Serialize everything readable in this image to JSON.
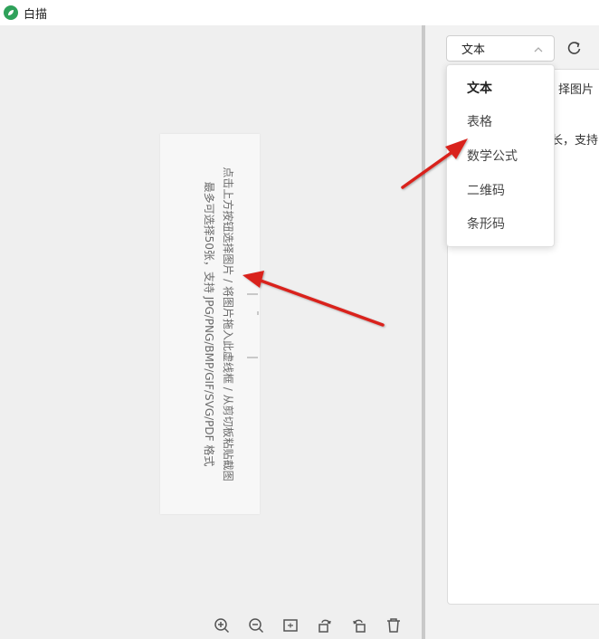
{
  "window": {
    "title": "白描",
    "logo_icon": "leaf-logo-icon",
    "logo_color": "#2fa15a"
  },
  "placeholder": {
    "line1": "点击上方按钮选择图片 / 将图片拖入此虚线框 / 从剪切板粘贴截图",
    "line2": "最多可选择50张，支持 JPG/PNG/BMP/GIF/SVG/PDF 格式"
  },
  "toolbar": {
    "icons": [
      "zoom-in-icon",
      "zoom-out-icon",
      "fit-icon",
      "rotate-right-icon",
      "rotate-left-icon",
      "delete-icon"
    ]
  },
  "select": {
    "value": "文本",
    "chevron_icon": "chevron-up-icon"
  },
  "refresh_icon": "refresh-icon",
  "dropdown": {
    "items": [
      "文本",
      "表格",
      "数学公式",
      "二维码",
      "条形码"
    ],
    "selected_index": 0
  },
  "result": {
    "line1_partial": "择图片",
    "line2_partial": "长，支持"
  },
  "colors": {
    "annotation_arrow": "#d9211c",
    "background": "#efefef",
    "splitter": "#c9c9c9"
  }
}
